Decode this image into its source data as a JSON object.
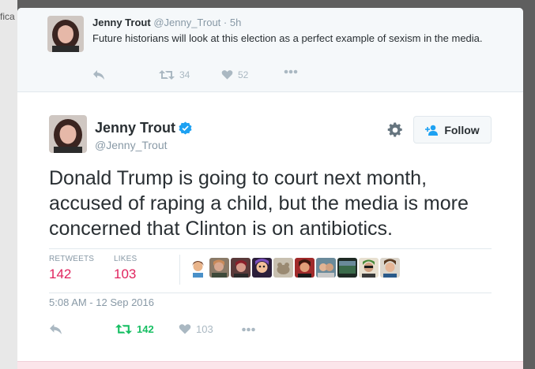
{
  "background": {
    "partial_text": "fica"
  },
  "parent_tweet": {
    "name": "Jenny Trout",
    "handle": "@Jenny_Trout",
    "time": "· 5h",
    "text": "Future historians will look at this election as a perfect example of sexism in the media.",
    "retweets": "34",
    "likes": "52"
  },
  "main_tweet": {
    "name": "Jenny Trout",
    "verified": true,
    "handle": "@Jenny_Trout",
    "follow_label": "Follow",
    "text": "Donald Trump is going to court next month, accused of raping a child, but the media is more concerned that Clinton is on antibiotics.",
    "retweets_label": "RETWEETS",
    "retweets": "142",
    "likes_label": "LIKES",
    "likes": "103",
    "timestamp": "5:08 AM - 12 Sep 2016",
    "action_retweets": "142",
    "action_likes": "103",
    "liker_avatar_count": 10
  },
  "colors": {
    "accent_blue": "#1da1f2",
    "retweet_green": "#17bf63",
    "like_pink": "#e0245e",
    "muted": "#aab8c2"
  }
}
